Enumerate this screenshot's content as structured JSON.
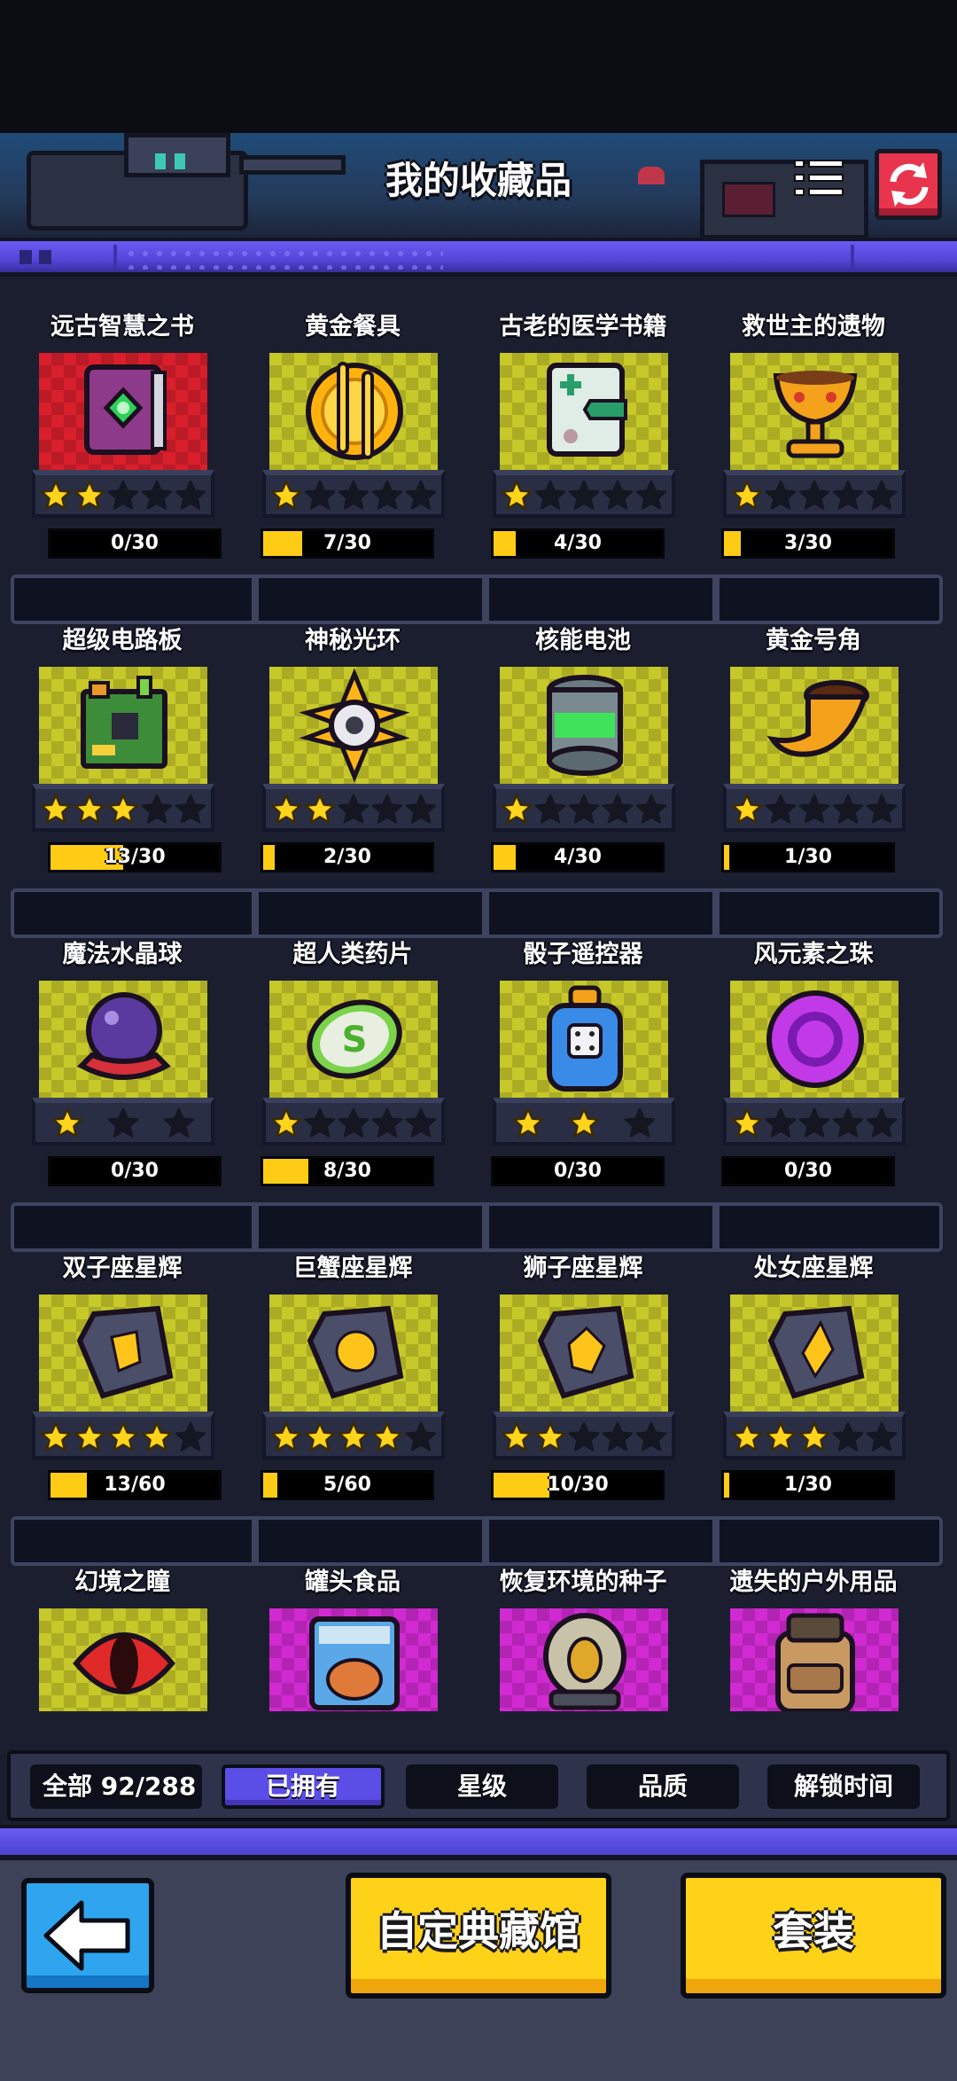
{
  "header": {
    "title": "我的收藏品"
  },
  "collection_rows": [
    [
      {
        "name": "远古智慧之书",
        "stars": 2,
        "progress_text": "0/30",
        "progress": 0.0,
        "icon": "book-icon",
        "bg": "red"
      },
      {
        "name": "黄金餐具",
        "stars": 1,
        "progress_text": "7/30",
        "progress": 0.233,
        "icon": "golden-cutlery-icon",
        "bg": "yellow"
      },
      {
        "name": "古老的医学书籍",
        "stars": 1,
        "progress_text": "4/30",
        "progress": 0.133,
        "icon": "medical-book-icon",
        "bg": "yellow"
      },
      {
        "name": "救世主的遗物",
        "stars": 1,
        "progress_text": "3/30",
        "progress": 0.1,
        "icon": "chalice-icon",
        "bg": "yellow"
      }
    ],
    [
      {
        "name": "超级电路板",
        "stars": 3,
        "progress_text": "13/30",
        "progress": 0.433,
        "icon": "circuit-board-icon",
        "bg": "yellow"
      },
      {
        "name": "神秘光环",
        "stars": 2,
        "progress_text": "2/30",
        "progress": 0.067,
        "icon": "mystic-halo-icon",
        "bg": "yellow"
      },
      {
        "name": "核能电池",
        "stars": 1,
        "progress_text": "4/30",
        "progress": 0.133,
        "icon": "nuclear-battery-icon",
        "bg": "yellow"
      },
      {
        "name": "黄金号角",
        "stars": 1,
        "progress_text": "1/30",
        "progress": 0.033,
        "icon": "golden-horn-icon",
        "bg": "yellow"
      }
    ],
    [
      {
        "name": "魔法水晶球",
        "stars": 1,
        "max_stars": 3,
        "progress_text": "0/30",
        "progress": 0.0,
        "icon": "crystal-ball-icon",
        "bg": "yellow"
      },
      {
        "name": "超人类药片",
        "stars": 1,
        "progress_text": "8/30",
        "progress": 0.267,
        "icon": "superhuman-pill-icon",
        "bg": "yellow"
      },
      {
        "name": "骰子遥控器",
        "stars": 2,
        "max_stars": 3,
        "progress_text": "0/30",
        "progress": 0.0,
        "icon": "dice-remote-icon",
        "bg": "yellow"
      },
      {
        "name": "风元素之珠",
        "stars": 1,
        "progress_text": "0/30",
        "progress": 0.0,
        "icon": "wind-orb-icon",
        "bg": "yellow"
      }
    ],
    [
      {
        "name": "双子座星辉",
        "stars": 4,
        "progress_text": "13/60",
        "progress": 0.217,
        "icon": "gemini-emblem-icon",
        "bg": "yellow"
      },
      {
        "name": "巨蟹座星辉",
        "stars": 4,
        "progress_text": "5/60",
        "progress": 0.083,
        "icon": "cancer-emblem-icon",
        "bg": "yellow"
      },
      {
        "name": "狮子座星辉",
        "stars": 2,
        "progress_text": "10/30",
        "progress": 0.333,
        "icon": "leo-emblem-icon",
        "bg": "yellow"
      },
      {
        "name": "处女座星辉",
        "stars": 3,
        "progress_text": "1/30",
        "progress": 0.033,
        "icon": "virgo-emblem-icon",
        "bg": "yellow"
      }
    ],
    [
      {
        "name": "幻境之瞳",
        "icon": "illusion-eye-icon",
        "bg": "yellow"
      },
      {
        "name": "罐头食品",
        "icon": "canned-food-icon",
        "bg": "pink"
      },
      {
        "name": "恢复环境的种子",
        "icon": "seed-capsule-icon",
        "bg": "pink"
      },
      {
        "name": "遗失的户外用品",
        "icon": "backpack-icon",
        "bg": "pink"
      }
    ]
  ],
  "filter": {
    "total": "全部 92/288",
    "owned": "已拥有",
    "stars": "星级",
    "quality": "品质",
    "unlock_time": "解锁时间"
  },
  "footer": {
    "custom_museum": "自定典藏馆",
    "set": "套装"
  },
  "colors": {
    "accent_purple": "#5b4ee6",
    "gold": "#ffd21a",
    "back_blue": "#2ea5ee",
    "refresh_red": "#e8344c"
  }
}
